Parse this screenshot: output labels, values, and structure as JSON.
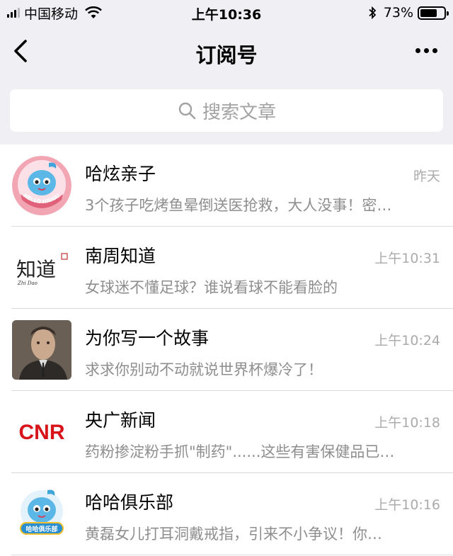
{
  "status_bar": {
    "carrier": "中国移动",
    "time": "上午10:36",
    "battery_percent": "73%",
    "battery_level": 0.73
  },
  "nav": {
    "title": "订阅号",
    "back_icon": "chevron-left-icon",
    "more_icon": "more-dots-icon"
  },
  "search": {
    "placeholder": "搜索文章",
    "icon": "search-icon"
  },
  "colors": {
    "background_gray": "#efeff4",
    "text_secondary": "#8e8e8e",
    "time_gray": "#ababab",
    "cnr_red": "#d7141a"
  },
  "accounts": [
    {
      "name": "哈炫亲子",
      "time": "昨天",
      "preview": "3个孩子吃烤鱼晕倒送医抢救，大人没事！密…",
      "avatar_text": "HELLO HAHA!"
    },
    {
      "name": "南周知道",
      "time": "上午10:31",
      "preview": "女球迷不懂足球？谁说看球不能看脸的",
      "avatar_text": "知道",
      "avatar_sub": "Zhi Dao"
    },
    {
      "name": "为你写一个故事",
      "time": "上午10:24",
      "preview": "求求你别动不动就说世界杯爆冷了！"
    },
    {
      "name": "央广新闻",
      "time": "上午10:18",
      "preview": "药粉掺淀粉手抓\"制药\"......这些有害保健品已…",
      "avatar_text": "CNR"
    },
    {
      "name": "哈哈俱乐部",
      "time": "上午10:16",
      "preview": "黄磊女儿打耳洞戴戒指，引来不小争议！你…",
      "avatar_text": "哈哈俱乐部"
    }
  ]
}
